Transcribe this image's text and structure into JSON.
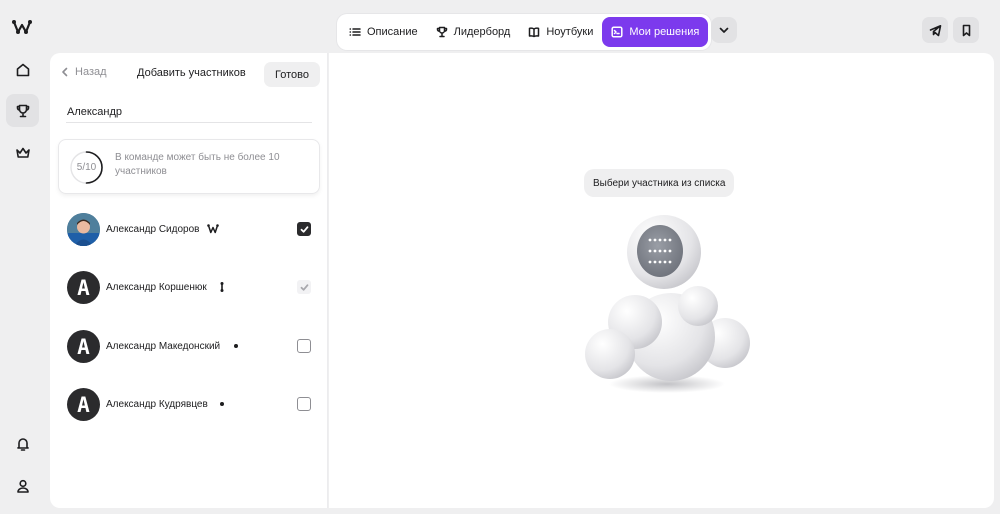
{
  "tabs": [
    {
      "label": "Описание",
      "icon": "list-icon"
    },
    {
      "label": "Лидерборд",
      "icon": "trophy-icon"
    },
    {
      "label": "Ноутбуки",
      "icon": "book-icon"
    },
    {
      "label": "Мои решения",
      "icon": "terminal-icon",
      "active": true
    }
  ],
  "panel": {
    "back_label": "Назад",
    "title": "Добавить участников",
    "done_label": "Готово"
  },
  "search": {
    "value": "Александр"
  },
  "limit": {
    "count": "5/10",
    "text": "В команде может быть не более 10 участников"
  },
  "users": [
    {
      "name": "Александр Сидоров",
      "checked": true
    },
    {
      "name": "Александр Коршенюк",
      "checked": true,
      "disabled": true
    },
    {
      "name": "Александр Македонский",
      "checked": false
    },
    {
      "name": "Александр Кудрявцев",
      "checked": false
    }
  ],
  "hint": {
    "text": "Выбери участника из списка"
  },
  "colors": {
    "accent": "#7c3aed",
    "avatar_bg": "#2b2b2d"
  }
}
